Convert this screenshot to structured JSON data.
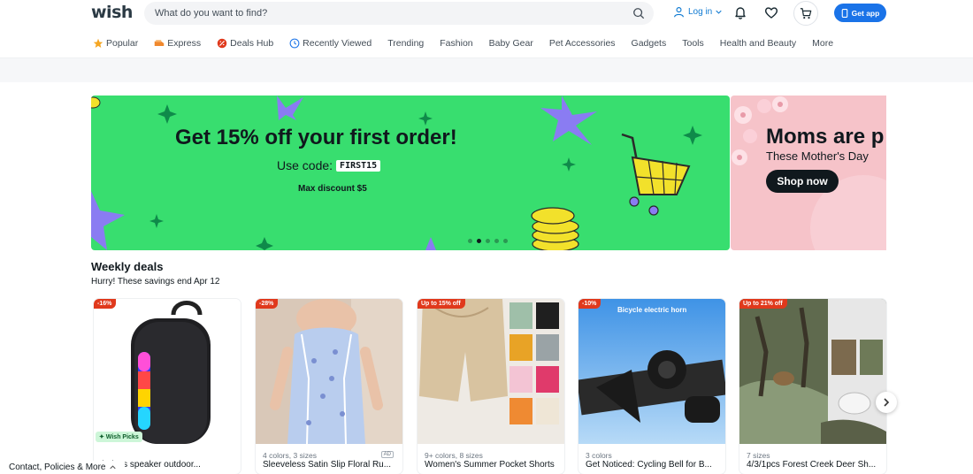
{
  "header": {
    "logo": "wish",
    "search_placeholder": "What do you want to find?",
    "login_label": "Log in",
    "get_app_label": "Get app"
  },
  "nav": {
    "items": [
      {
        "label": "Popular",
        "icon": "star-icon",
        "color": "#f5a623"
      },
      {
        "label": "Express",
        "icon": "express-icon",
        "color": "#f0882d"
      },
      {
        "label": "Deals Hub",
        "icon": "deals-icon",
        "color": "#e0391c"
      },
      {
        "label": "Recently Viewed",
        "icon": "clock-icon",
        "color": "#1a73e8"
      },
      {
        "label": "Trending"
      },
      {
        "label": "Fashion"
      },
      {
        "label": "Baby Gear"
      },
      {
        "label": "Pet Accessories"
      },
      {
        "label": "Gadgets"
      },
      {
        "label": "Tools"
      },
      {
        "label": "Health and Beauty"
      },
      {
        "label": "More"
      }
    ]
  },
  "hero": {
    "title": "Get 15% off your first order!",
    "code_prefix": "Use code:",
    "code": "FIRST15",
    "max_discount": "Max discount $5",
    "slide_count": 5,
    "active_slide": 2,
    "bg_color": "#38de6f"
  },
  "hero2": {
    "title": "Moms are p",
    "subtitle": "These Mother's Day",
    "cta": "Shop now"
  },
  "weekly": {
    "title": "Weekly deals",
    "subtitle": "Hurry! These savings end Apr 12"
  },
  "products": [
    {
      "badge": "-16%",
      "meta": "",
      "name": "wireless speaker outdoor...",
      "wish_picks": "✦ Wish Picks"
    },
    {
      "badge": "-28%",
      "meta": "4 colors, 3 sizes",
      "name": "Sleeveless Satin Slip Floral Ru...",
      "ad": "AD"
    },
    {
      "badge": "Up to 15% off",
      "meta": "9+ colors, 8 sizes",
      "name": "Women's Summer Pocket Shorts"
    },
    {
      "badge": "-10%",
      "meta": "3 colors",
      "name": "Get Noticed: Cycling Bell for B...",
      "img_text": "Bicycle electric horn"
    },
    {
      "badge": "Up to 21% off",
      "meta": "7 sizes",
      "name": "4/3/1pcs Forest Creek Deer Sh..."
    }
  ],
  "footer": {
    "link": "Contact, Policies & More"
  }
}
